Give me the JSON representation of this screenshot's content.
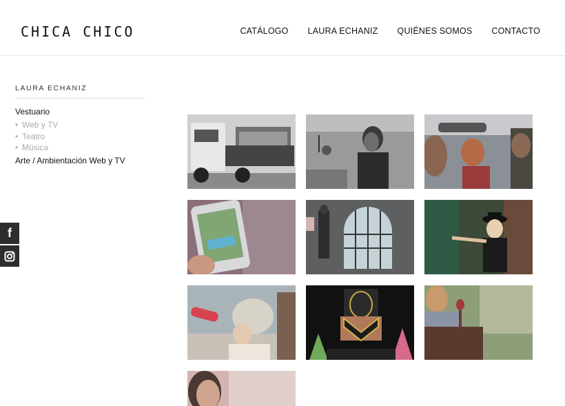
{
  "header": {
    "logo": "CHICA CHICO",
    "nav": [
      "CATÁLOGO",
      "LAURA ECHANIZ",
      "QUIÉNES SOMOS",
      "CONTACTO"
    ]
  },
  "sidebar": {
    "title": "LAURA ECHANIZ",
    "category1": "Vestuario",
    "subitems": [
      "Web y TV",
      "Teatro",
      "Música"
    ],
    "category2": "Arte / Ambientación Web y TV"
  },
  "social": {
    "facebook": "f",
    "instagram": "instagram-icon"
  },
  "gallery": {
    "items": [
      "truck-photo",
      "woman-kitchen-photo",
      "car-passengers-photo",
      "phone-pool-photo",
      "arched-window-photo",
      "woman-hat-photo",
      "drinking-woman-photo",
      "wrestler-photo",
      "man-chair-photo",
      "smiling-woman-photo"
    ]
  }
}
